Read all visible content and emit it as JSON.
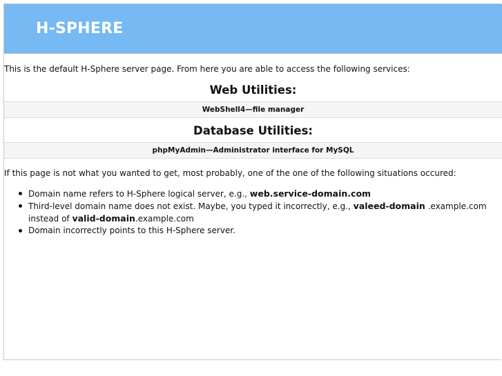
{
  "header": {
    "brand": "H-SPHERE",
    "background_color": "#76b9f3"
  },
  "intro_text": "This is the default H-Sphere server page. From here you are able to access the following services:",
  "web_utilities": {
    "title": "Web Utilities:",
    "link_label": "WebShell4—file manager"
  },
  "database_utilities": {
    "title": "Database Utilities:",
    "link_label": "phpMyAdmin—Administrator interface for MySQL"
  },
  "situations": {
    "intro": "If this page is not what you wanted to get, most probably, one of the one of the following situations occured:",
    "items": [
      {
        "text_before": "Domain name refers to H-Sphere logical server, e.g., ",
        "bold": "web.service-domain.com",
        "text_after": ""
      },
      {
        "text_before": "Third-level domain name does not exist. Maybe, you typed it incorrectly, e.g., ",
        "bold": "valeed-domain",
        "text_middle": " .example.com instead of ",
        "bold2": "valid-domain",
        "text_after": ".example.com"
      },
      {
        "text_before": "Domain incorrectly points to this H-Sphere server.",
        "bold": "",
        "text_after": ""
      }
    ]
  }
}
